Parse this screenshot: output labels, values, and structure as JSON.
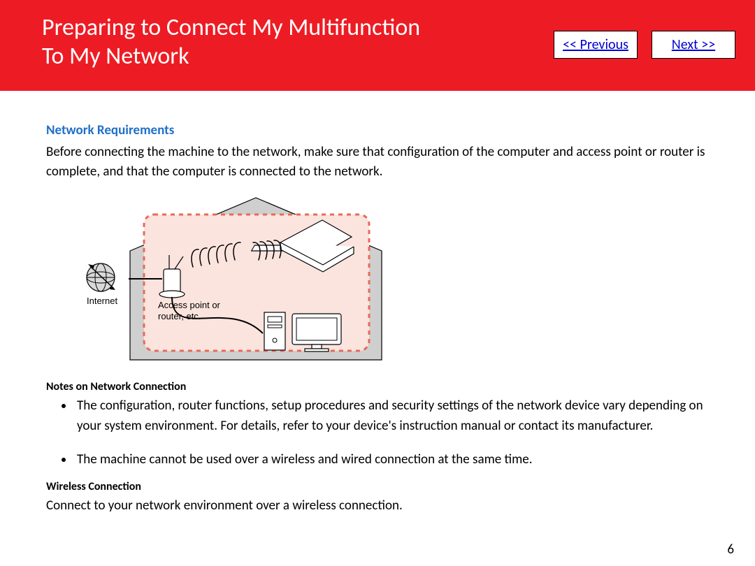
{
  "header": {
    "title_line1": "Preparing to Connect My Multifunction",
    "title_line2": "To My Network",
    "prev_label": "<< Previous",
    "next_label": "Next >>"
  },
  "section": {
    "heading": "Network Requirements",
    "intro": "Before connecting the machine to the network, make sure that configuration of the computer and access point or router is complete, and that the computer is connected to the network."
  },
  "diagram": {
    "internet_label": "Internet",
    "ap_label_l1": "Access point or",
    "ap_label_l2": "router, etc."
  },
  "notes": {
    "heading": "Notes on Network Connection",
    "items": [
      "The configuration, router functions, setup procedures and security settings of the network device vary depending on your system environment. For details, refer to your device's instruction manual or contact its manufacturer.",
      "The machine cannot be used over a wireless and wired connection at the same time."
    ]
  },
  "wireless": {
    "heading": "Wireless Connection",
    "text": "Connect to your network environment over a wireless connection."
  },
  "page_number": "6"
}
